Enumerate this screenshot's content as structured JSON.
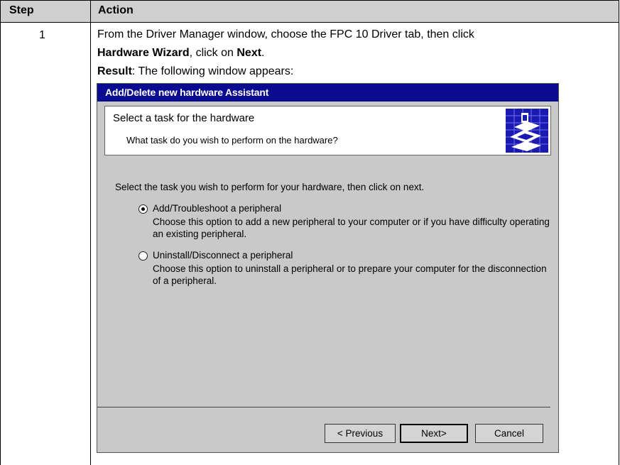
{
  "table": {
    "header_step": "Step",
    "header_action": "Action",
    "step_number": "1",
    "line1": "From the Driver Manager window, choose the FPC 10 Driver tab, then click",
    "line2_bold_a": "Hardware Wizard",
    "line2_mid": ", click on ",
    "line2_bold_b": "Next",
    "line2_end": ".",
    "result_label": "Result",
    "result_text": ": The following window appears:"
  },
  "dialog": {
    "title": "Add/Delete new hardware Assistant",
    "banner_title": "Select a task for the hardware",
    "banner_subtitle": "What task do you wish to perform on the hardware?",
    "wizard_icon": "hardware-wizard-icon",
    "prompt": "Select the task you wish to perform for your hardware, then click on next.",
    "options": [
      {
        "label": "Add/Troubleshoot a peripheral",
        "description": "Choose this option to add a new peripheral to your computer or if you have difficulty operating an existing peripheral.",
        "selected": true
      },
      {
        "label": "Uninstall/Disconnect a peripheral",
        "description": "Choose this option to uninstall a peripheral or to prepare your computer for the disconnection of a peripheral.",
        "selected": false
      }
    ],
    "buttons": {
      "previous": "< Previous",
      "next": "Next>",
      "cancel": "Cancel"
    },
    "colors": {
      "titlebar": "#0b0b8f",
      "dialog_bg": "#c9c9c9"
    }
  }
}
